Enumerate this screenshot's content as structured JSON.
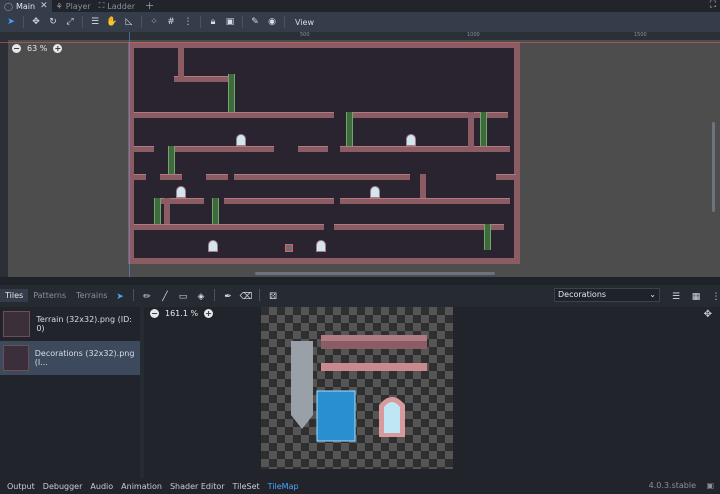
{
  "scene_tabs": [
    {
      "label": "Main",
      "icon": "node-icon",
      "active": true
    },
    {
      "label": "Player",
      "icon": "character-icon",
      "active": false
    },
    {
      "label": "Ladder",
      "icon": "area-icon",
      "active": false
    }
  ],
  "toolbar": {
    "view_label": "View"
  },
  "viewport": {
    "zoom": "63 %",
    "ruler_labels": [
      "500",
      "1000",
      "1500"
    ]
  },
  "panel": {
    "tabs": [
      "Tiles",
      "Patterns",
      "Terrains"
    ],
    "layer_select": "Decorations",
    "sources": [
      {
        "label": "Terrain (32x32).png (ID: 0)"
      },
      {
        "label": "Decorations (32x32).png (I..."
      }
    ],
    "atlas_zoom": "161.1 %"
  },
  "bottom_tabs": [
    "Output",
    "Debugger",
    "Audio",
    "Animation",
    "Shader Editor",
    "TileSet",
    "TileMap"
  ],
  "version": "4.0.3.stable",
  "colors": {
    "accent": "#4aa3ff",
    "brick": "#8c5c64",
    "background": "#4d4d4d"
  }
}
